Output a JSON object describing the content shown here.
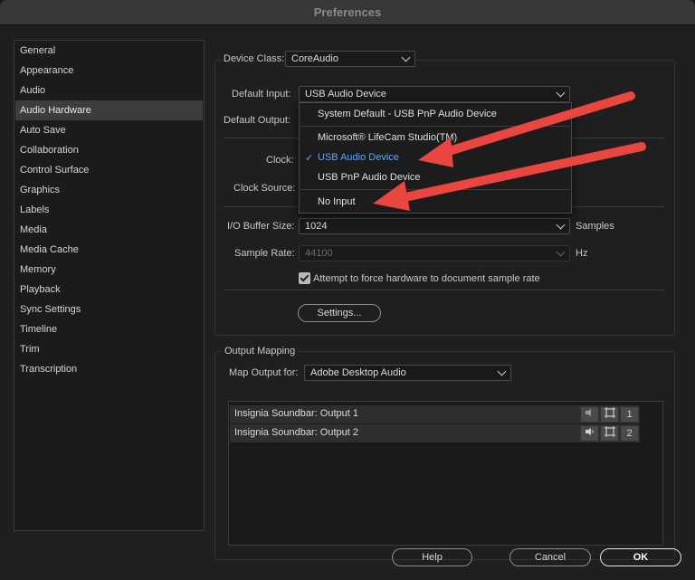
{
  "window": {
    "title": "Preferences"
  },
  "sidebar": {
    "items": [
      {
        "label": "General"
      },
      {
        "label": "Appearance"
      },
      {
        "label": "Audio"
      },
      {
        "label": "Audio Hardware",
        "selected": true
      },
      {
        "label": "Auto Save"
      },
      {
        "label": "Collaboration"
      },
      {
        "label": "Control Surface"
      },
      {
        "label": "Graphics"
      },
      {
        "label": "Labels"
      },
      {
        "label": "Media"
      },
      {
        "label": "Media Cache"
      },
      {
        "label": "Memory"
      },
      {
        "label": "Playback"
      },
      {
        "label": "Sync Settings"
      },
      {
        "label": "Timeline"
      },
      {
        "label": "Trim"
      },
      {
        "label": "Transcription"
      }
    ]
  },
  "hardware": {
    "device_class_label": "Device Class:",
    "device_class_value": "CoreAudio",
    "default_input_label": "Default Input:",
    "default_input_value": "USB Audio Device",
    "default_output_label": "Default Output:",
    "clock_label": "Clock:",
    "clock_source_label": "Clock Source:",
    "io_buffer_label": "I/O Buffer Size:",
    "io_buffer_value": "1024",
    "io_buffer_unit": "Samples",
    "sample_rate_label": "Sample Rate:",
    "sample_rate_value": "44100",
    "sample_rate_unit": "Hz",
    "force_rate_label": "Attempt to force hardware to document sample rate",
    "force_rate_checked": true,
    "settings_button": "Settings..."
  },
  "input_dropdown": {
    "items": [
      {
        "label": "System Default - USB PnP Audio Device"
      },
      {
        "label": "Microsoft® LifeCam Studio(TM)"
      },
      {
        "label": "USB Audio Device",
        "checked": true
      },
      {
        "label": "USB PnP Audio Device"
      },
      {
        "label": "No Input"
      }
    ],
    "check_glyph": "✓",
    "active_color": "#5aa9ff"
  },
  "output_mapping": {
    "title": "Output Mapping",
    "map_output_label": "Map Output for:",
    "map_output_value": "Adobe Desktop Audio",
    "rows": [
      {
        "label": "Insignia Soundbar: Output 1",
        "channel": "1"
      },
      {
        "label": "Insignia Soundbar: Output 2",
        "channel": "2"
      }
    ]
  },
  "footer": {
    "help": "Help",
    "cancel": "Cancel",
    "ok": "OK"
  },
  "annotation": {
    "arrow_color": "#e8463f"
  },
  "icons": [
    "chevron-down-icon",
    "checkmark-icon",
    "speaker-icon",
    "mute-icon",
    "crop-icon",
    "red-arrow"
  ]
}
